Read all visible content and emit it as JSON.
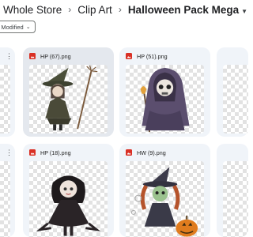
{
  "breadcrumb": {
    "items": [
      "Whole Store",
      "Clip Art",
      "Halloween Pack Mega"
    ]
  },
  "filter_chip": {
    "label": "Modified"
  },
  "files": [
    {
      "name": ""
    },
    {
      "name": "HP (67).png"
    },
    {
      "name": "HP (51).png"
    },
    {
      "name": ""
    },
    {
      "name": ""
    },
    {
      "name": "HP (18).png"
    },
    {
      "name": "HW (9).png"
    },
    {
      "name": ""
    }
  ],
  "icons": {
    "file_type": "image-file-icon",
    "more": "more-vert-icon",
    "dropdown": "arrow-drop-down-icon",
    "chip_chevron": "chevron-down-icon"
  },
  "colors": {
    "card_bg": "#f0f4f9",
    "card_selected_bg": "#e4e8ee",
    "file_icon": "#d93025",
    "text": "#1f1f1f"
  }
}
